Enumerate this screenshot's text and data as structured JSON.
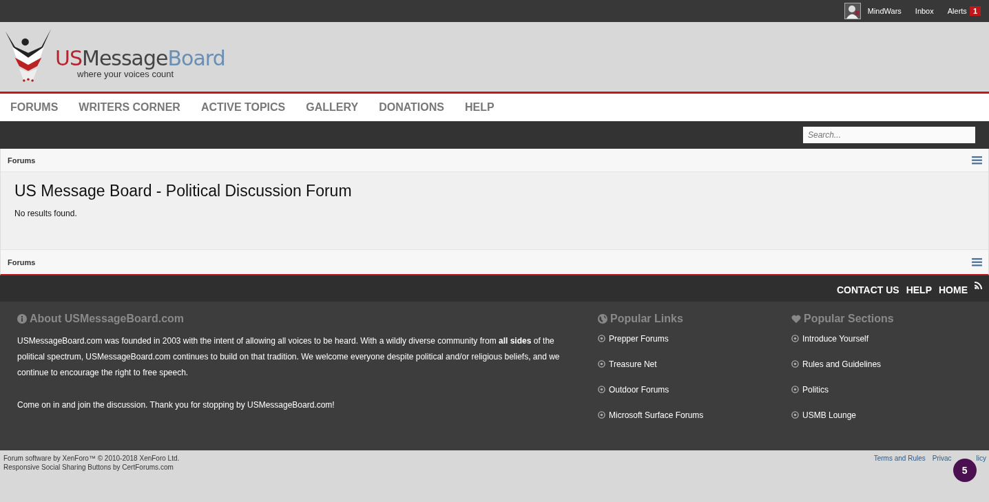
{
  "top_bar": {
    "user": "MindWars",
    "links": [
      {
        "label": "Inbox"
      },
      {
        "label": "Alerts",
        "badge": "1"
      }
    ]
  },
  "logo": {
    "parts": [
      "US",
      "Message",
      "Board"
    ],
    "tagline": "where your voices count"
  },
  "nav": [
    {
      "label": "FORUMS"
    },
    {
      "label": "WRITERS CORNER"
    },
    {
      "label": "ACTIVE TOPICS"
    },
    {
      "label": "GALLERY"
    },
    {
      "label": "DONATIONS"
    },
    {
      "label": "HELP"
    }
  ],
  "search": {
    "placeholder": "Search..."
  },
  "breadcrumb_top": "Forums",
  "page_title": "US Message Board - Political Discussion Forum",
  "message": "No results found.",
  "breadcrumb_bottom": "Forums",
  "footer_links": [
    "CONTACT US",
    "HELP",
    "HOME"
  ],
  "about": {
    "title": "About USMessageBoard.com",
    "paragraphs": [
      "USMessageBoard.com was founded in 2003 with the intent of allowing all voices to be heard. With a wildly diverse community from **all sides** of the political spectrum, USMessageBoard.com continues to build on that tradition. We welcome everyone despite political and/or religious beliefs, and we continue to encourage the right to free speech.",
      "Come on in and join the discussion. Thank you for stopping by USMessageBoard.com!"
    ]
  },
  "columns": [
    {
      "kind": "globe",
      "title": "Popular Links",
      "items": [
        "Prepper Forums",
        "Treasure Net",
        "Outdoor Forums",
        "Microsoft Surface Forums"
      ]
    },
    {
      "kind": "heart",
      "title": "Popular Sections",
      "items": [
        "Introduce Yourself",
        "Rules and Guidelines",
        "Politics",
        "USMB Lounge"
      ]
    }
  ],
  "copyright": [
    "Forum software by XenForo™ © 2010-2018 XenForo Ltd.",
    "Responsive Social Sharing Buttons by CertForums.com"
  ],
  "legal_links": [
    "Terms and Rules",
    "Privac"
  ],
  "legal_tail": "licy",
  "floating_badge": "5"
}
